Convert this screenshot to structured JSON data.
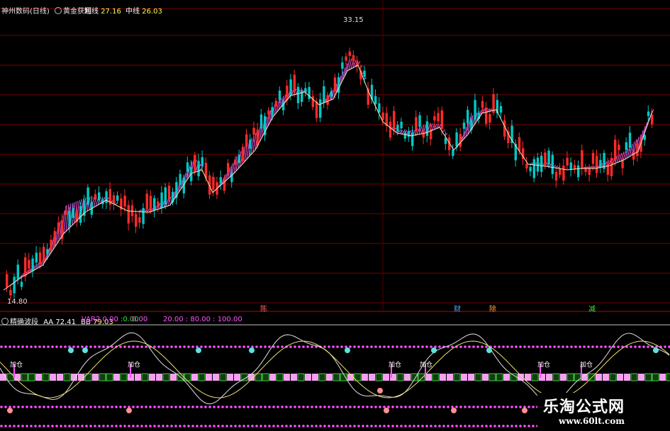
{
  "main_panel": {
    "stock_name": "神州数码(日线)",
    "indicator_name": "黄金获利",
    "short_line_label": "短线",
    "short_line_value": "27.16",
    "mid_line_label": "中线",
    "mid_line_value": "26.03",
    "high_label": "33.15",
    "low_label": "14.80"
  },
  "event_markers": [
    {
      "label": "陈",
      "color": "#ff6060"
    },
    {
      "label": "财",
      "color": "#4aa8ff"
    },
    {
      "label": "除",
      "color": "#ffa040"
    },
    {
      "label": "减",
      "color": "#40e040"
    }
  ],
  "sub_panel": {
    "indicator_name": "精确波段",
    "aa_label": "AA",
    "aa_value": "72.41",
    "bb_label": "BB",
    "bb_value": "79.03",
    "var2_label": "VAR2",
    "var2_value_1": "0.00",
    "var2_value_2": ":0.00",
    "value_3": "0.00",
    "levels_text": "20.00 : 80.00 : 100.00",
    "signal_label": "加仓"
  },
  "colors": {
    "up": "#ff2a2a",
    "down": "#00c8c8",
    "band": "#d050d0",
    "mid_line": "#f0e8b0",
    "dotted": "#ff50ff",
    "grid": "#7a0000"
  },
  "watermark": {
    "title": "乐淘公式网",
    "url": "www.60lt.com"
  }
}
